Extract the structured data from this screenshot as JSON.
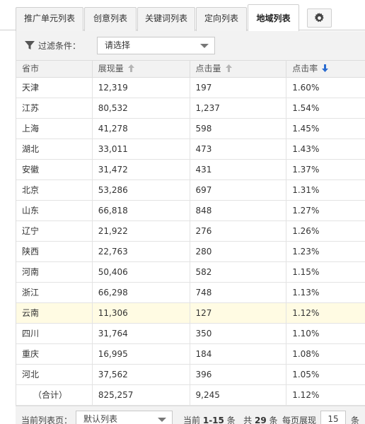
{
  "tabs": [
    {
      "label": "推广单元列表",
      "active": false
    },
    {
      "label": "创意列表",
      "active": false
    },
    {
      "label": "关键词列表",
      "active": false
    },
    {
      "label": "定向列表",
      "active": false
    },
    {
      "label": "地域列表",
      "active": true
    }
  ],
  "settings_icon": "gear-icon",
  "filter": {
    "label": "过滤条件：",
    "select_value": "请选择",
    "icon": "funnel-icon"
  },
  "table": {
    "columns": [
      {
        "label": "省市",
        "sort": "none"
      },
      {
        "label": "展现量",
        "sort": "inactive"
      },
      {
        "label": "点击量",
        "sort": "inactive"
      },
      {
        "label": "点击率",
        "sort": "descending"
      }
    ],
    "rows": [
      [
        "天津",
        "12,319",
        "197",
        "1.60%"
      ],
      [
        "江苏",
        "80,532",
        "1,237",
        "1.54%"
      ],
      [
        "上海",
        "41,278",
        "598",
        "1.45%"
      ],
      [
        "湖北",
        "33,011",
        "473",
        "1.43%"
      ],
      [
        "安徽",
        "31,472",
        "431",
        "1.37%"
      ],
      [
        "北京",
        "53,286",
        "697",
        "1.31%"
      ],
      [
        "山东",
        "66,818",
        "848",
        "1.27%"
      ],
      [
        "辽宁",
        "21,922",
        "276",
        "1.26%"
      ],
      [
        "陕西",
        "22,763",
        "280",
        "1.23%"
      ],
      [
        "河南",
        "50,406",
        "582",
        "1.15%"
      ],
      [
        "浙江",
        "66,298",
        "748",
        "1.13%"
      ],
      [
        "云南",
        "11,306",
        "127",
        "1.12%"
      ],
      [
        "四川",
        "31,764",
        "350",
        "1.10%"
      ],
      [
        "重庆",
        "16,995",
        "184",
        "1.08%"
      ],
      [
        "河北",
        "37,562",
        "396",
        "1.05%"
      ]
    ],
    "highlighted_row": 11,
    "total": [
      "（合计）",
      "825,257",
      "9,245",
      "1.12%"
    ]
  },
  "pager": {
    "page_label": "当前列表页：",
    "page_select": "默认列表",
    "current_prefix": "当前",
    "current_range": "1-15",
    "current_suffix": "条",
    "total_prefix": "共",
    "total_count": "29",
    "total_suffix": "条",
    "page_size_label": "每页展现",
    "page_size": "15",
    "page_size_unit": "条"
  },
  "colors": {
    "sort_active": "#2a6bd0",
    "sort_inactive": "#b5b5b5",
    "highlight_row": "#fffbe3",
    "header_bg": "#f2f2f2"
  }
}
